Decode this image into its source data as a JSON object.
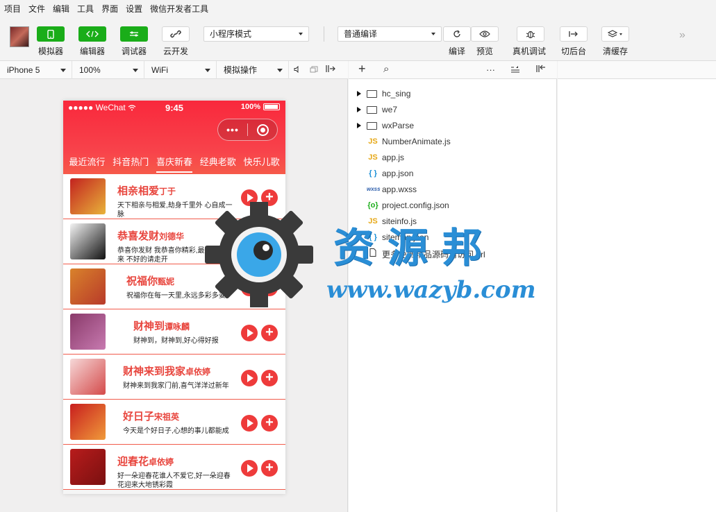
{
  "menu": [
    "项目",
    "文件",
    "编辑",
    "工具",
    "界面",
    "设置",
    "微信开发者工具"
  ],
  "toolbar": {
    "simulator": "模拟器",
    "editor": "编辑器",
    "debugger": "调试器",
    "cloud": "云开发",
    "mode_select": "小程序模式",
    "compile_select": "普通编译",
    "compile": "编译",
    "preview": "预览",
    "real_debug": "真机调试",
    "background": "切后台",
    "clear_cache": "清缓存",
    "more_glyph": "»"
  },
  "simbar": {
    "device": "iPhone 5",
    "zoom": "100%",
    "network": "WiFi",
    "operation": "模拟操作"
  },
  "phone": {
    "carrier": "●●●●● WeChat",
    "time": "9:45",
    "battery": "100%",
    "capsule_dots": "•••",
    "tabs": [
      "最近流行",
      "抖音热门",
      "喜庆新春",
      "经典老歌",
      "快乐儿歌"
    ],
    "active_tab": 2,
    "songs": [
      {
        "title": "相亲相爱",
        "artist": "丁于",
        "desc": "天下相亲与相爱,劫身千里外 心自成一脉",
        "colors": [
          "#c3221f",
          "#e8b33a"
        ]
      },
      {
        "title": "恭喜发财",
        "artist": "刘德华",
        "desc": "恭喜你发财 我恭喜你精彩,最好的请过来 不好的请走开",
        "colors": [
          "#f4f4f4",
          "#111111"
        ]
      },
      {
        "title": "祝福你",
        "artist": "甄妮",
        "desc": "祝福你在每一天里,永远多彩多姿",
        "colors": [
          "#d9822b",
          "#b83a2a"
        ]
      },
      {
        "title": "财神到",
        "artist": "谭咏麟",
        "desc": "财神到，财神到,好心得好报",
        "colors": [
          "#8a3a6a",
          "#c77ab0"
        ]
      },
      {
        "title": "财神来到我家",
        "artist": "卓依婷",
        "desc": "财神来到我家门前,喜气洋洋过新年",
        "colors": [
          "#f6d8d8",
          "#d44a4a"
        ]
      },
      {
        "title": "好日子",
        "artist": "宋祖英",
        "desc": "今天是个好日子,心想的事儿都能成",
        "colors": [
          "#c81e1e",
          "#f09a3a"
        ]
      },
      {
        "title": "迎春花",
        "artist": "卓依婷",
        "desc": "好一朵迎春花谁人不爱它,好一朵迎春花迎来大地锈彩霞",
        "colors": [
          "#b81c1c",
          "#7a1010"
        ]
      }
    ]
  },
  "filebar": {
    "add": "+",
    "search": "⌕",
    "more": "···"
  },
  "files": [
    {
      "name": "hc_sing",
      "type": "folder"
    },
    {
      "name": "we7",
      "type": "folder"
    },
    {
      "name": "wxParse",
      "type": "folder"
    },
    {
      "name": "NumberAnimate.js",
      "type": "js",
      "icon": "JS"
    },
    {
      "name": "app.js",
      "type": "js",
      "icon": "JS"
    },
    {
      "name": "app.json",
      "type": "json",
      "icon": "{ }"
    },
    {
      "name": "app.wxss",
      "type": "wxss",
      "icon": "wxss"
    },
    {
      "name": "project.config.json",
      "type": "config",
      "icon": "{o}"
    },
    {
      "name": "siteinfo.js",
      "type": "js",
      "icon": "JS"
    },
    {
      "name": "sitemap.json",
      "type": "json",
      "icon": "{ }"
    },
    {
      "name": "更多免费精品源码请访问.url",
      "type": "file",
      "icon": ""
    }
  ],
  "watermark": {
    "cn": "资源邦",
    "url": "www.wazyb.com"
  },
  "colors": {
    "accent": "#1aad19",
    "header": "#f9283c",
    "song_title": "#e8463e",
    "js_icon": "#e6a817",
    "json_icon": "#1a8fd6",
    "config_icon": "#1aad19",
    "wxss_icon": "#2a5caa"
  }
}
